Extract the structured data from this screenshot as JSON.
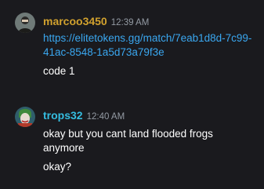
{
  "messages": [
    {
      "username": "marcoo3450",
      "username_color": "#d1a12e",
      "timestamp": "12:39 AM",
      "avatar_icon": "user-avatar-dark",
      "lines": {
        "link": "https://elitetokens.gg/match/7eab1d8d-7c99-41ac-8548-1a5d73a79f3e",
        "text1": "code 1"
      }
    },
    {
      "username": "trops32",
      "username_color": "#35bde0",
      "timestamp": "12:40 AM",
      "avatar_icon": "user-avatar-joker",
      "lines": {
        "text1": "okay but you cant land flooded frogs anymore",
        "text2": "okay?"
      }
    }
  ],
  "colors": {
    "background": "#1a1a1e",
    "link": "#3aa7f0",
    "timestamp": "#949ba4",
    "message_text": "#ffffff"
  }
}
